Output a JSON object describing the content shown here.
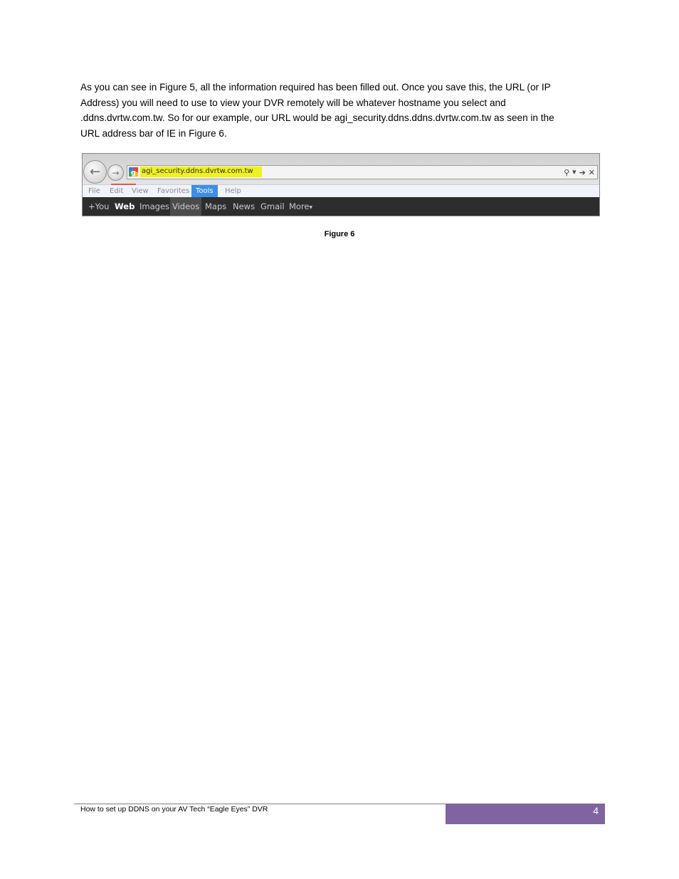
{
  "body": {
    "lines": [
      "As you can see in Figure 5, all the information required has been filled out. Once you save this, the URL (or IP",
      "Address) you will need to use to view your DVR remotely will be whatever hostname you select and",
      ".ddns.dvrtw.com.tw. So for our example, our URL would be agi_security.ddns.ddns.dvrtw.com.tw as seen in the",
      "URL address bar of IE in Figure 6."
    ]
  },
  "figure": {
    "caption": "Figure 6",
    "browser": {
      "url": "agi_security.ddns.dvrtw.com.tw",
      "url_highlight_color": "#f1f21c",
      "nav_icons": {
        "back": "back-arrow-icon",
        "forward": "forward-arrow-icon"
      },
      "address_icons": {
        "search": "⚲",
        "dropdown": "▼",
        "go": "➔",
        "stop": "✕"
      },
      "menu": [
        "File",
        "Edit",
        "View",
        "Favorites",
        "Tools",
        "Help"
      ],
      "menu_active": "Tools",
      "menu_active_color": "#3d8ee8",
      "google_bar": [
        "+You",
        "Web",
        "Images",
        "Videos",
        "Maps",
        "News",
        "Gmail",
        "More"
      ],
      "google_bar_more_arrow": "▾"
    }
  },
  "footer": {
    "text": "How to set up DDNS on your AV Tech “Eagle Eyes” DVR",
    "page_number": "4",
    "accent_color": "#8064a2"
  }
}
